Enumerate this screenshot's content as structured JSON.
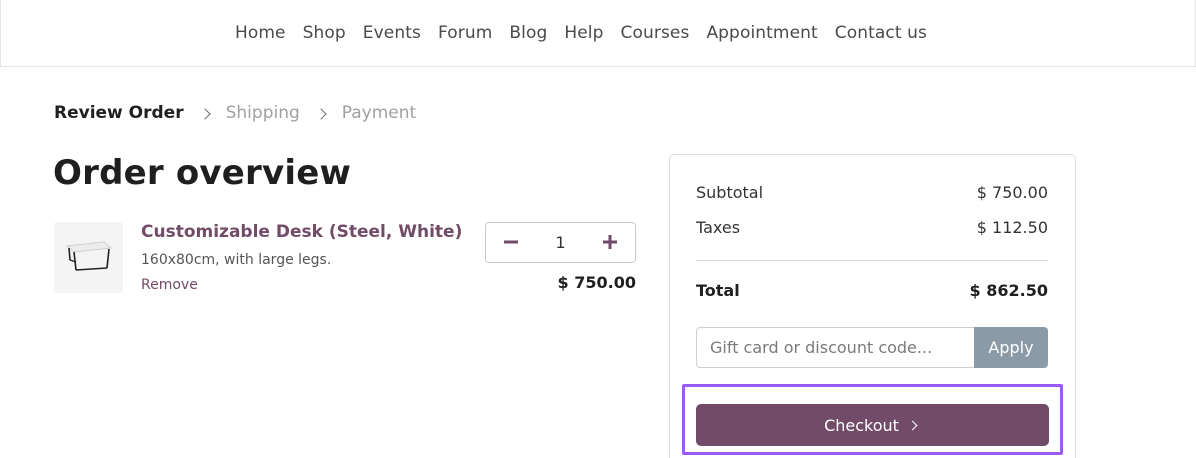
{
  "nav": {
    "items": [
      "Home",
      "Shop",
      "Events",
      "Forum",
      "Blog",
      "Help",
      "Courses",
      "Appointment",
      "Contact us"
    ]
  },
  "breadcrumb": {
    "steps": [
      "Review Order",
      "Shipping",
      "Payment"
    ],
    "active_step": "Review Order"
  },
  "page": {
    "title": "Order overview"
  },
  "cart": {
    "product": {
      "name": "Customizable Desk (Steel, White)",
      "description": "160x80cm, with large legs.",
      "remove_label": "Remove",
      "quantity": "1",
      "price": "$ 750.00",
      "image_icon": "desk-icon"
    },
    "decrease_icon": "minus-icon",
    "increase_icon": "plus-icon"
  },
  "summary": {
    "subtotal_label": "Subtotal",
    "subtotal_value": "$ 750.00",
    "taxes_label": "Taxes",
    "taxes_value": "$ 112.50",
    "total_label": "Total",
    "total_value": "$ 862.50",
    "promo_placeholder": "Gift card or discount code...",
    "apply_label": "Apply",
    "checkout_label": "Checkout",
    "checkout_icon": "chevron-right-icon"
  },
  "colors": {
    "brand": "#714b67",
    "apply_button": "#8a9aa6",
    "highlight": "#9c5cf4"
  }
}
